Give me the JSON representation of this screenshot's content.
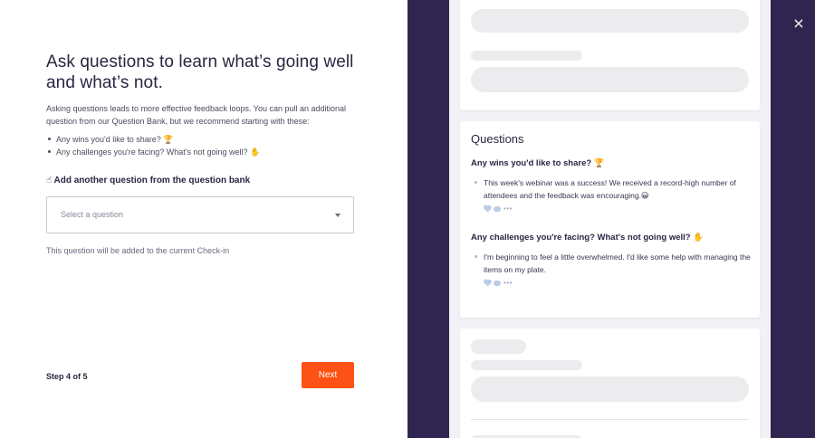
{
  "left": {
    "title": "Ask questions to learn what’s going well and what’s not.",
    "intro": "Asking questions leads to more effective feedback loops. You can pull an additional question from our Question Bank, but we recommend starting with these:",
    "bullets": [
      "Any wins you'd like to share? 🏆",
      "Any challenges you're facing? What's not going well? ✋"
    ],
    "add_heading": "☝ Add another question from the question bank",
    "select": {
      "placeholder": "Select a question",
      "icon": "caret-down-icon"
    },
    "hint": "This question will be added to the current Check-in",
    "step": "Step 4 of 5",
    "next_label": "Next",
    "accent": "#fe5116"
  },
  "preview": {
    "background": "#2f2550",
    "questions_title": "Questions",
    "items": [
      {
        "question": "Any wins you'd like to share? 🏆",
        "answer": "This week's webinar was a success! We received a record-high number of attendees and the feedback was encouraging.😀"
      },
      {
        "question": "Any challenges you're facing? What's not going well? ✋",
        "answer": "I'm beginning to feel a little overwhelmed. I'd like some help with managing the items on my plate."
      }
    ],
    "reaction_dots": "•••"
  },
  "close_icon": "×"
}
